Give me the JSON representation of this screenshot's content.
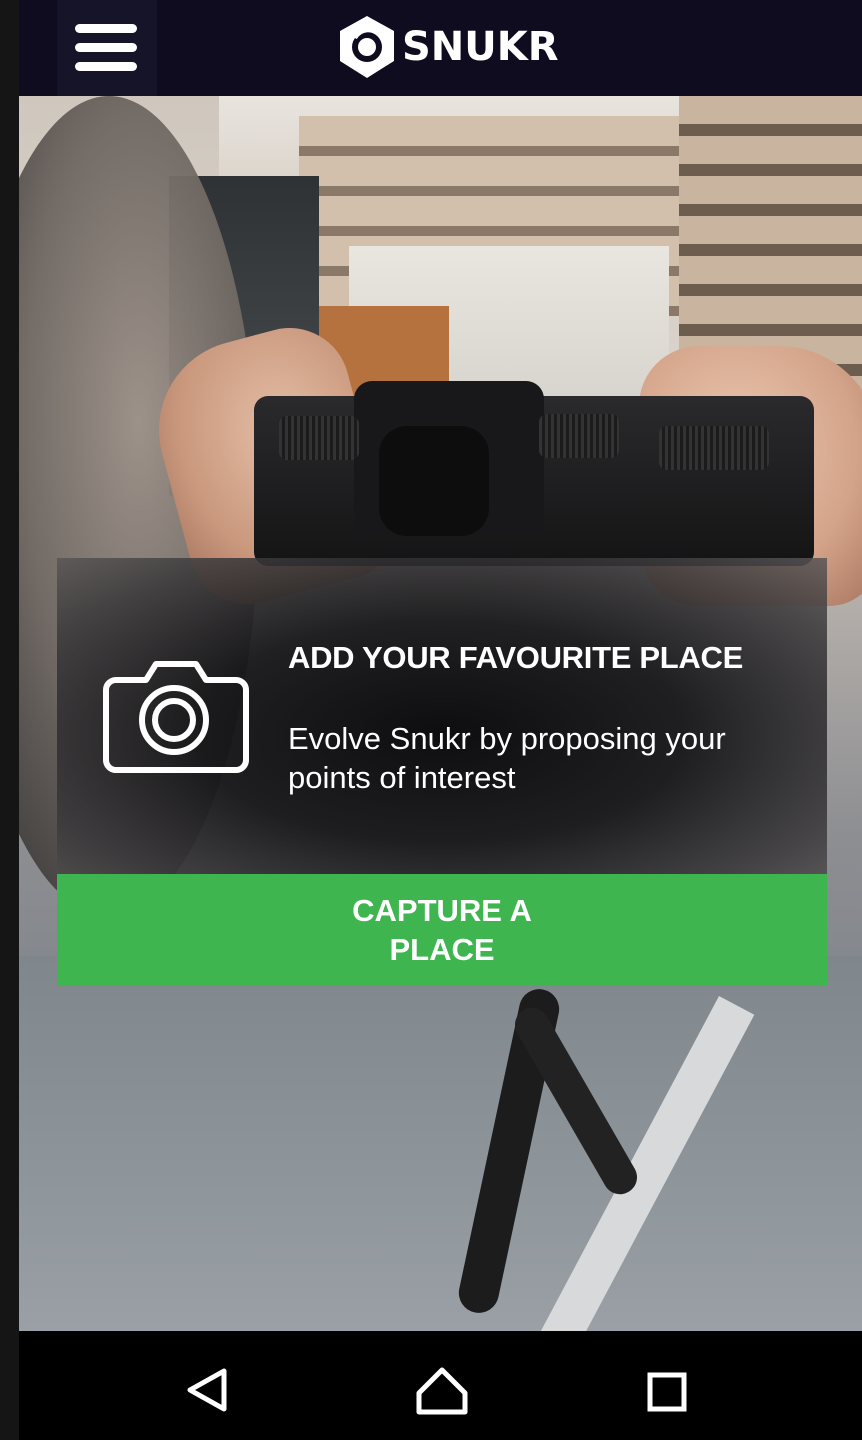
{
  "app": {
    "brand_name": "SNUKR",
    "logo_icon": "snukr-logo-icon",
    "menu_icon": "hamburger-menu-icon"
  },
  "card": {
    "icon": "camera-icon",
    "title": "ADD YOUR FAVOURITE PLACE",
    "description": "Evolve Snukr by proposing your points of interest",
    "button_label": "CAPTURE A PLACE"
  },
  "navbar": {
    "back_icon": "back-triangle-icon",
    "home_icon": "home-icon",
    "recents_icon": "recents-square-icon"
  },
  "colors": {
    "topbar_bg": "#0e0c1e",
    "accent_green": "#3fb54f",
    "text": "#ffffff",
    "navbar_bg": "#000000"
  }
}
